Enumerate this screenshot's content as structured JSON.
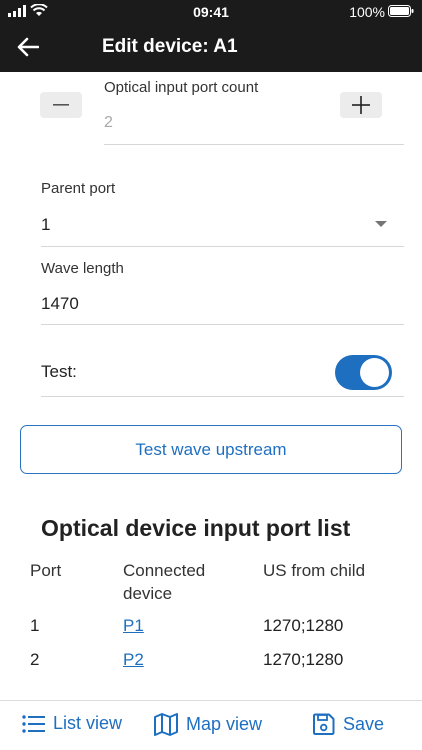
{
  "status_bar": {
    "time": "09:41",
    "battery": "100%"
  },
  "app_bar": {
    "title": "Edit device: A1"
  },
  "optical_input": {
    "label": "Optical input port count",
    "value": "2"
  },
  "parent_port": {
    "label": "Parent port",
    "value": "1"
  },
  "wave_length": {
    "label": "Wave length",
    "value": "1470"
  },
  "test": {
    "label": "Test:",
    "enabled": true
  },
  "upstream_button": {
    "label": "Test wave upstream"
  },
  "port_list": {
    "title": "Optical device input port list",
    "headers": [
      "Port",
      "Connected\ndevice",
      "US from child"
    ],
    "rows": [
      {
        "port": "1",
        "device": "P1",
        "us": "1270;1280"
      },
      {
        "port": "2",
        "device": "P2",
        "us": "1270;1280"
      }
    ]
  },
  "bottom_nav": {
    "list_view": "List view",
    "map_view": "Map view",
    "save": "Save"
  },
  "colors": {
    "accent": "#1f6fc1",
    "bar": "#1b1b1b",
    "toggle_on": "#1f6fc1"
  }
}
